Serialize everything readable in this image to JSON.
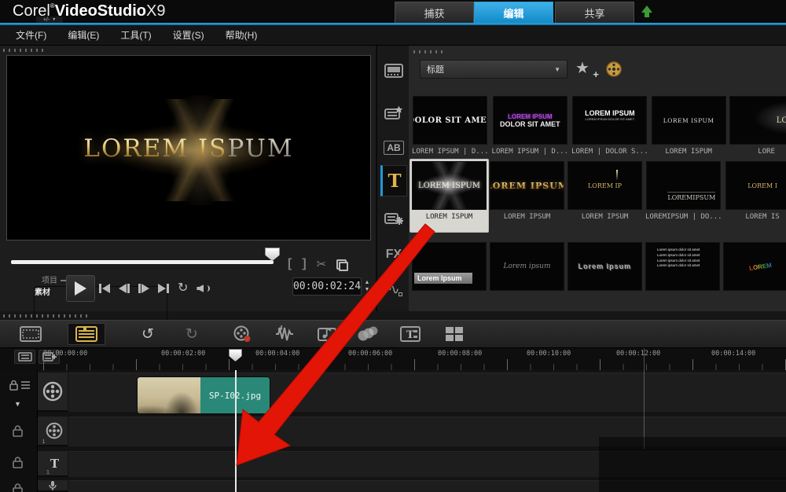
{
  "brand": {
    "corel": "Corel",
    "reg": "®",
    "product": "VideoStudio",
    "version": "X9"
  },
  "top_tabs": {
    "capture": "捕获",
    "edit": "编辑",
    "share": "共享"
  },
  "menus": {
    "file": "文件(F)",
    "edit": "编辑(E)",
    "tools": "工具(T)",
    "settings": "设置(S)",
    "help": "帮助(H)"
  },
  "preview": {
    "title_text_gold": "LOREM IS",
    "title_text_silver": "PUM",
    "project_label": "项目",
    "clip_label": "素材",
    "timecode": "00:00:02:24"
  },
  "glyphs": {
    "dropdown_arrow": "▼",
    "spinner_up": "▲",
    "spinner_down": "▼",
    "mark_in": "[",
    "mark_out": "]",
    "scissors": "✂",
    "undo": "↺",
    "redo": "↻",
    "repeat": "↻",
    "collapse_arrow": "▼",
    "ab_label": "AB",
    "t_label": "T",
    "fx_label": "FX",
    "motion_wave": "∿",
    "star": "★",
    "plus": "+",
    "track_sub_1": "1",
    "title_track_t": "T"
  },
  "library": {
    "category": "标题",
    "items": [
      {
        "text": "DOLOR SIT AMET",
        "style": "bold-white",
        "caption": "LOREM IPSUM | D..."
      },
      {
        "text": "LOREM IPSUM",
        "text2": "DOLOR SIT AMET",
        "style": "purple-stack",
        "caption": "LOREM IPSUM | D..."
      },
      {
        "text": "LOREM IPSUM",
        "text2": "LOREM IPSUM DOLOR SIT AMET",
        "style": "white-sub",
        "caption": "LOREM | DOLOR S..."
      },
      {
        "text": "LOREM ISPUM",
        "style": "small-white",
        "caption": "LOREM ISPUM"
      },
      {
        "text": "LOREM",
        "style": "glow-clip",
        "caption": "LORE"
      },
      {
        "text": "LOREM ISPUM",
        "style": "burst",
        "caption": "LOREM ISPUM"
      },
      {
        "text": "LOREM IPSUM",
        "style": "gold",
        "caption": "LOREM IPSUM"
      },
      {
        "text": "LOREM IP",
        "style": "gold-drip",
        "caption": "LOREM IPSUM"
      },
      {
        "text": "LOREMIPSUM",
        "style": "serif-br",
        "caption": "LOREMIPSUM | DO..."
      },
      {
        "text": "LOREM I",
        "style": "gold-clip",
        "caption": "LOREM IS"
      },
      {
        "text": "Lorem Ipsum",
        "style": "lower-third",
        "caption": ""
      },
      {
        "text": "Lorem ipsum",
        "style": "italic-gray",
        "caption": ""
      },
      {
        "text": "Lorem Ipsum",
        "style": "outline",
        "caption": ""
      },
      {
        "text": "Lorem ipsum dolor sit amet Lorem ipsum dolor sit amet Lorem ipsum dolor sit amet Lorem ipsum dolor sit amet",
        "style": "text-block",
        "caption": ""
      },
      {
        "text": "LOREM",
        "style": "color-logo",
        "caption": ""
      }
    ]
  },
  "timeline": {
    "ruler_labels": [
      "00:00:00:00",
      "00:00:02:00",
      "00:00:04:00",
      "00:00:06:00",
      "00:00:08:00",
      "00:00:10:00",
      "00:00:12:00",
      "00:00:14:00"
    ],
    "clip_name": "SP-I02.jpg",
    "track_add_label": "+/-"
  },
  "colors": {
    "accent_blue": "#1f9ad6",
    "clip_teal": "#2a8878",
    "arrow_red": "#e31507",
    "gold": "#e2b24c"
  }
}
